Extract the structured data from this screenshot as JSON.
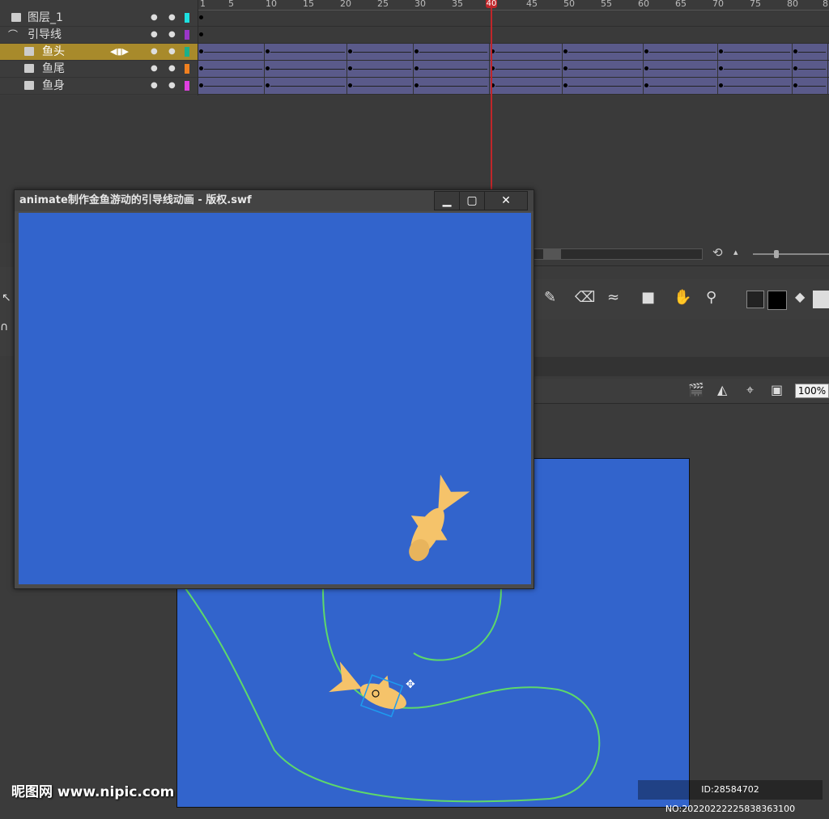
{
  "timeline": {
    "layers": [
      {
        "name": "图层_1",
        "color": "#1de0e0",
        "selected": false,
        "type": "normal"
      },
      {
        "name": "引导线",
        "color": "#9a36c8",
        "selected": false,
        "type": "guide"
      },
      {
        "name": "鱼头",
        "color": "#1ab08a",
        "selected": true,
        "type": "guided"
      },
      {
        "name": "鱼尾",
        "color": "#f08020",
        "selected": false,
        "type": "guided"
      },
      {
        "name": "鱼身",
        "color": "#e040e0",
        "selected": false,
        "type": "guided"
      }
    ],
    "ruler_ticks": [
      "1",
      "5",
      "10",
      "15",
      "20",
      "25",
      "30",
      "35",
      "40",
      "45",
      "50",
      "55",
      "60",
      "65",
      "70",
      "75",
      "80",
      "8"
    ],
    "current_frame": "40"
  },
  "swf_window": {
    "title": "animate制作金鱼游动的引导线动画 - 版权.swf",
    "minimize": "▁",
    "maximize": "▢",
    "close": "✕"
  },
  "zoom": "100%",
  "colors": {
    "stage": "#3264cc",
    "fish": "#f5c36a",
    "guide_path": "#5ed86a"
  },
  "watermark": {
    "brand": "昵图网 www.nipic.com",
    "id": "ID:28584702 NO:20220222225838363100"
  }
}
